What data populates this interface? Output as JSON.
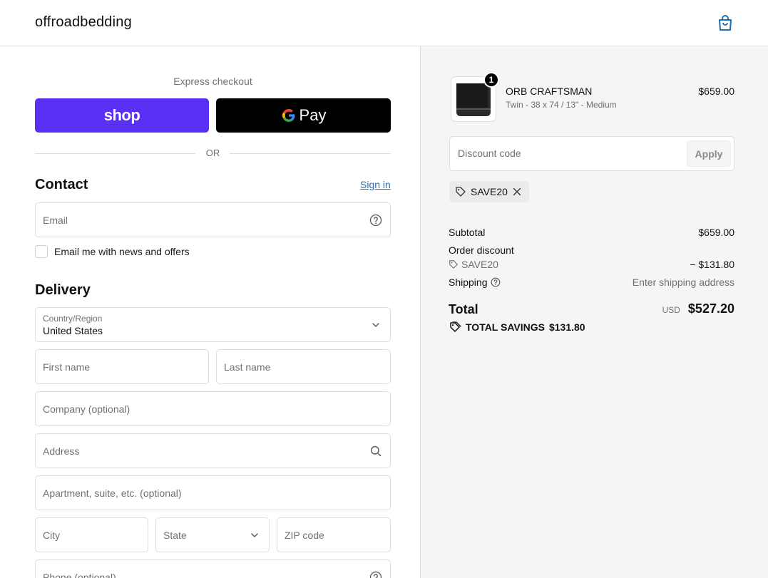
{
  "header": {
    "brand": "offroadbedding"
  },
  "express": {
    "label": "Express checkout",
    "shop_label": "shop",
    "gpay_label": "Pay",
    "or_label": "OR"
  },
  "contact": {
    "title": "Contact",
    "sign_in": "Sign in",
    "email_placeholder": "Email",
    "newsletter_label": "Email me with news and offers"
  },
  "delivery": {
    "title": "Delivery",
    "country_label": "Country/Region",
    "country_value": "United States",
    "first_name_placeholder": "First name",
    "last_name_placeholder": "Last name",
    "company_placeholder": "Company (optional)",
    "address_placeholder": "Address",
    "apartment_placeholder": "Apartment, suite, etc. (optional)",
    "city_placeholder": "City",
    "state_placeholder": "State",
    "zip_placeholder": "ZIP code",
    "phone_placeholder": "Phone (optional)"
  },
  "order": {
    "item": {
      "name": "ORB CRAFTSMAN",
      "variant": "Twin - 38 x 74 / 13\" - Medium",
      "price": "$659.00",
      "quantity": "1"
    },
    "discount_placeholder": "Discount code",
    "apply_label": "Apply",
    "applied_code": "SAVE20",
    "subtotal_label": "Subtotal",
    "subtotal_value": "$659.00",
    "order_discount_label": "Order discount",
    "order_discount_code": "SAVE20",
    "order_discount_value": "− $131.80",
    "shipping_label": "Shipping",
    "shipping_value": "Enter shipping address",
    "total_label": "Total",
    "total_currency": "USD",
    "total_value": "$527.20",
    "total_savings_label": "TOTAL SAVINGS",
    "total_savings_value": "$131.80"
  },
  "colors": {
    "shop_pay": "#5a31f4",
    "link": "#1f6fb2",
    "summary_bg": "#f5f5f5"
  }
}
